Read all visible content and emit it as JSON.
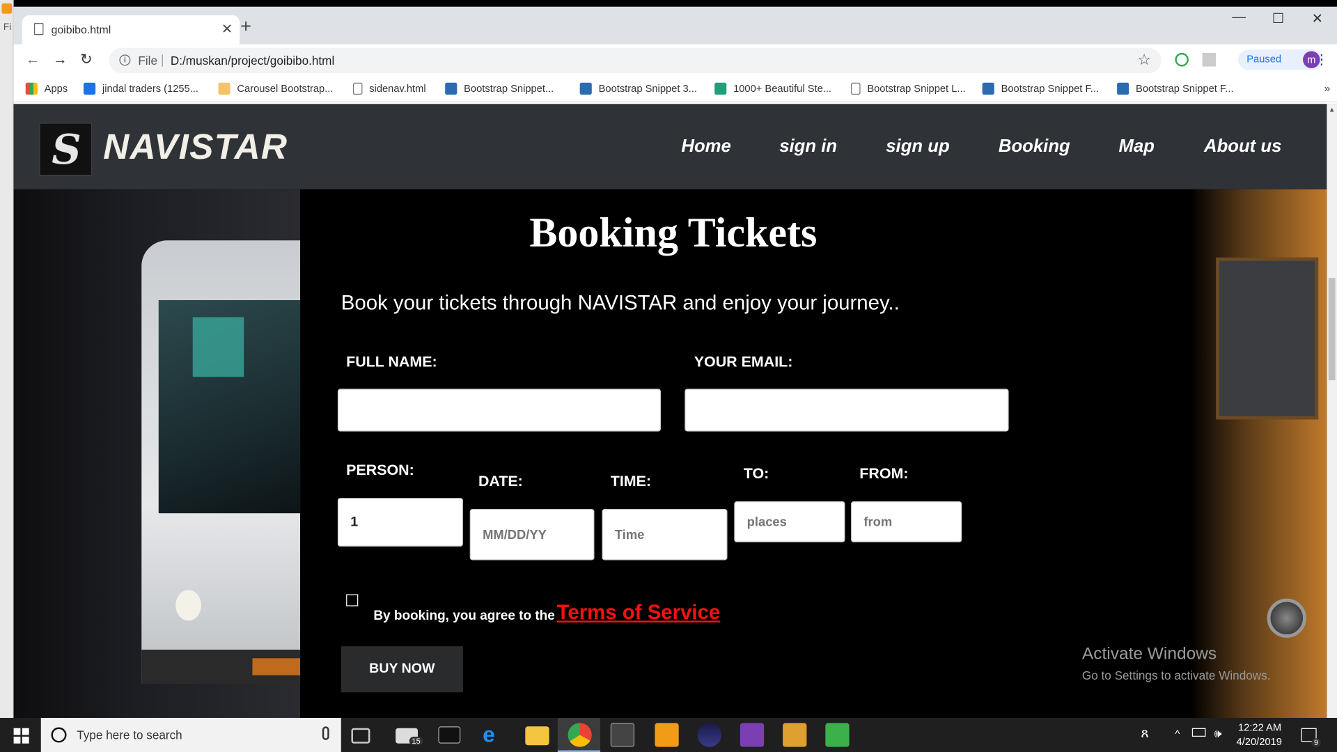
{
  "browser": {
    "tab_title": "goibibo.html",
    "new_tab": "+",
    "close": "✕",
    "file_label": "File",
    "url": "D:/muskan/project/goibibo.html",
    "profile_status": "Paused",
    "profile_initial": "m",
    "bookmarks": [
      {
        "label": "Apps",
        "color": "#e74c3c"
      },
      {
        "label": "jindal traders (1255...",
        "color": "#1a73e8"
      },
      {
        "label": "Carousel Bootstrap...",
        "color": "#f5a623"
      },
      {
        "label": "sidenav.html",
        "color": "#ffffff"
      },
      {
        "label": "Bootstrap Snippet...",
        "color": "#2b6cb0"
      },
      {
        "label": "Bootstrap Snippet 3...",
        "color": "#2b6cb0"
      },
      {
        "label": "1000+ Beautiful Ste...",
        "color": "#20a07a"
      },
      {
        "label": "Bootstrap Snippet L...",
        "color": "#ffffff"
      },
      {
        "label": "Bootstrap Snippet F...",
        "color": "#2b6cb0"
      },
      {
        "label": "Bootstrap Snippet F...",
        "color": "#2b6cb0"
      }
    ],
    "more": "»"
  },
  "site": {
    "brand": "NAVISTAR",
    "nav": [
      "Home",
      "sign in",
      "sign up",
      "Booking",
      "Map",
      "About us"
    ]
  },
  "booking": {
    "title": "Booking Tickets",
    "subtitle": "Book your tickets through NAVISTAR and enjoy your journey..",
    "labels": {
      "full_name": "FULL NAME:",
      "email": "YOUR EMAIL:",
      "person": "PERSON:",
      "date": "DATE:",
      "time": "TIME:",
      "to": "TO:",
      "from": "FROM:"
    },
    "values": {
      "full_name": "",
      "email": "",
      "person": "1",
      "date_placeholder": "MM/DD/YY",
      "time_placeholder": "Time",
      "to_placeholder": "places",
      "from_placeholder": "from"
    },
    "agree_text": "By booking, you agree to the",
    "terms_link": "Terms of Service",
    "buy_button": "BUY NOW"
  },
  "watermark": {
    "line1": "Activate Windows",
    "line2": "Go to Settings to activate Windows."
  },
  "taskbar": {
    "search_placeholder": "Type here to search",
    "time": "12:22 AM",
    "date": "4/20/2019",
    "mail_badge": "15",
    "notif_badge": "9"
  },
  "colors": {
    "nav_bg": "#2f3338",
    "terms_link": "#ff1010",
    "button_bg": "#2a2b2d"
  }
}
